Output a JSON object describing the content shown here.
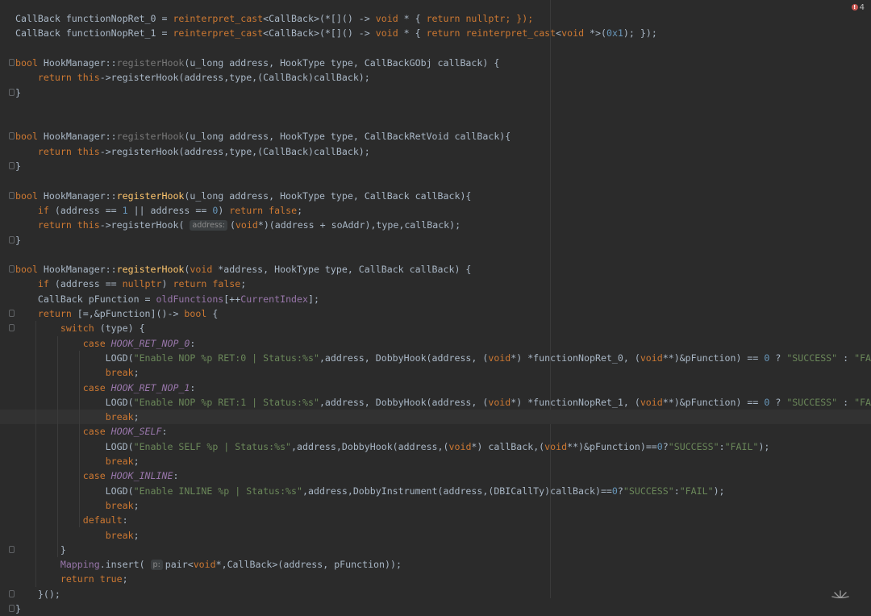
{
  "editor": {
    "error_count": "4",
    "error_icon": "error-icon",
    "lines": [
      {
        "tokens": [
          [
            "CallBack functionNopRet_0 = ",
            ""
          ],
          [
            "reinterpret_cast",
            "kw"
          ],
          [
            "<CallBack>(*[]() -> ",
            ""
          ],
          [
            "void",
            "kw"
          ],
          [
            " * { ",
            ""
          ],
          [
            "return",
            "kw"
          ],
          [
            " ",
            ""
          ],
          [
            "nullptr",
            "kw"
          ],
          [
            "; });",
            "kw"
          ]
        ]
      },
      {
        "tokens": [
          [
            "CallBack functionNopRet_1 = ",
            ""
          ],
          [
            "reinterpret_cast",
            "kw"
          ],
          [
            "<CallBack>(*[]() -> ",
            ""
          ],
          [
            "void",
            "kw"
          ],
          [
            " * { ",
            ""
          ],
          [
            "return",
            "kw"
          ],
          [
            " ",
            ""
          ],
          [
            "reinterpret_cast",
            "kw"
          ],
          [
            "<",
            ""
          ],
          [
            "void",
            "kw"
          ],
          [
            " *>(",
            ""
          ],
          [
            "0x1",
            "num"
          ],
          [
            "); });",
            ""
          ]
        ]
      },
      {
        "tokens": []
      },
      {
        "fold": true,
        "tokens": [
          [
            "bool",
            "kw"
          ],
          [
            " HookManager::",
            ""
          ],
          [
            "registerHook",
            "dim"
          ],
          [
            "(u_long address, HookType type, CallBackGObj callBack) {",
            ""
          ]
        ]
      },
      {
        "tokens": [
          [
            "    ",
            ""
          ],
          [
            "return",
            "kw"
          ],
          [
            " ",
            ""
          ],
          [
            "this",
            "kw"
          ],
          [
            "->registerHook(address,type,(CallBack)callBack);",
            ""
          ]
        ]
      },
      {
        "fold": true,
        "tokens": [
          [
            "}",
            ""
          ]
        ]
      },
      {
        "tokens": []
      },
      {
        "tokens": []
      },
      {
        "fold": true,
        "tokens": [
          [
            "bool",
            "kw"
          ],
          [
            " HookManager::",
            ""
          ],
          [
            "registerHook",
            "dim"
          ],
          [
            "(u_long address, HookType type, CallBackRetVoid callBack){",
            ""
          ]
        ]
      },
      {
        "tokens": [
          [
            "    ",
            ""
          ],
          [
            "return",
            "kw"
          ],
          [
            " ",
            ""
          ],
          [
            "this",
            "kw"
          ],
          [
            "->registerHook(address,type,(CallBack)callBack);",
            ""
          ]
        ]
      },
      {
        "fold": true,
        "tokens": [
          [
            "}",
            ""
          ]
        ]
      },
      {
        "tokens": []
      },
      {
        "fold": true,
        "tokens": [
          [
            "bool",
            "kw"
          ],
          [
            " HookManager::",
            ""
          ],
          [
            "registerHook",
            "fn"
          ],
          [
            "(u_long address, HookType type, CallBack callBack){",
            ""
          ]
        ]
      },
      {
        "tokens": [
          [
            "    ",
            ""
          ],
          [
            "if",
            "kw"
          ],
          [
            " (address == ",
            ""
          ],
          [
            "1",
            "num"
          ],
          [
            " || address == ",
            ""
          ],
          [
            "0",
            "num"
          ],
          [
            ") ",
            ""
          ],
          [
            "return",
            "kw"
          ],
          [
            " ",
            ""
          ],
          [
            "false",
            "kw"
          ],
          [
            ";",
            ""
          ]
        ]
      },
      {
        "tokens": [
          [
            "    ",
            ""
          ],
          [
            "return",
            "kw"
          ],
          [
            " ",
            ""
          ],
          [
            "this",
            "kw"
          ],
          [
            "->registerHook( ",
            ""
          ],
          [
            "address:",
            "hint"
          ],
          [
            "(",
            ""
          ],
          [
            "void",
            "kw"
          ],
          [
            "*)(address + soAddr),type,callBack);",
            ""
          ]
        ]
      },
      {
        "fold": true,
        "tokens": [
          [
            "}",
            ""
          ]
        ]
      },
      {
        "tokens": []
      },
      {
        "fold": true,
        "tokens": [
          [
            "bool",
            "kw"
          ],
          [
            " HookManager::",
            ""
          ],
          [
            "registerHook",
            "fn"
          ],
          [
            "(",
            ""
          ],
          [
            "void",
            "kw"
          ],
          [
            " *address, HookType type, CallBack callBack) {",
            ""
          ]
        ]
      },
      {
        "tokens": [
          [
            "    ",
            ""
          ],
          [
            "if",
            "kw"
          ],
          [
            " (address == ",
            ""
          ],
          [
            "nullptr",
            "kw"
          ],
          [
            ") ",
            ""
          ],
          [
            "return",
            "kw"
          ],
          [
            " ",
            ""
          ],
          [
            "false",
            "kw"
          ],
          [
            ";",
            ""
          ]
        ]
      },
      {
        "tokens": [
          [
            "    CallBack pFunction = ",
            ""
          ],
          [
            "oldFunctions",
            "field"
          ],
          [
            "[++",
            ""
          ],
          [
            "CurrentIndex",
            "field"
          ],
          [
            "];",
            ""
          ]
        ]
      },
      {
        "fold": true,
        "tokens": [
          [
            "    ",
            ""
          ],
          [
            "return",
            "kw"
          ],
          [
            " [=,&pFunction]()-> ",
            ""
          ],
          [
            "bool",
            "kw"
          ],
          [
            " {",
            ""
          ]
        ]
      },
      {
        "fold": true,
        "tokens": [
          [
            "        ",
            ""
          ],
          [
            "switch",
            "kw"
          ],
          [
            " (type) {",
            ""
          ]
        ]
      },
      {
        "tokens": [
          [
            "            ",
            ""
          ],
          [
            "case",
            "kw"
          ],
          [
            " ",
            ""
          ],
          [
            "HOOK_RET_NOP_0",
            "const"
          ],
          [
            ":",
            ""
          ]
        ]
      },
      {
        "tokens": [
          [
            "                LOGD(",
            ""
          ],
          [
            "\"Enable NOP %p RET:0 | Status:%s\"",
            "str"
          ],
          [
            ",address, DobbyHook(address, (",
            ""
          ],
          [
            "void",
            "kw"
          ],
          [
            "*) *functionNopRet_0, (",
            ""
          ],
          [
            "void",
            "kw"
          ],
          [
            "**)&pFunction) == ",
            ""
          ],
          [
            "0",
            "num"
          ],
          [
            " ? ",
            ""
          ],
          [
            "\"SUCCESS\"",
            "str"
          ],
          [
            " : ",
            ""
          ],
          [
            "\"FAIL\"",
            "str"
          ],
          [
            ");",
            ""
          ]
        ]
      },
      {
        "tokens": [
          [
            "                ",
            ""
          ],
          [
            "break",
            "kw"
          ],
          [
            ";",
            ""
          ]
        ]
      },
      {
        "tokens": [
          [
            "            ",
            ""
          ],
          [
            "case",
            "kw"
          ],
          [
            " ",
            ""
          ],
          [
            "HOOK_RET_NOP_1",
            "const"
          ],
          [
            ":",
            ""
          ]
        ]
      },
      {
        "tokens": [
          [
            "                LOGD(",
            ""
          ],
          [
            "\"Enable NOP %p RET:1 | Status:%s\"",
            "str"
          ],
          [
            ",address, DobbyHook(address, (",
            ""
          ],
          [
            "void",
            "kw"
          ],
          [
            "*) *functionNopRet_1, (",
            ""
          ],
          [
            "void",
            "kw"
          ],
          [
            "**)&pFunction) == ",
            ""
          ],
          [
            "0",
            "num"
          ],
          [
            " ? ",
            ""
          ],
          [
            "\"SUCCESS\"",
            "str"
          ],
          [
            " : ",
            ""
          ],
          [
            "\"FAIL\"",
            "str"
          ],
          [
            ");",
            ""
          ]
        ]
      },
      {
        "caret": true,
        "tokens": [
          [
            "                ",
            ""
          ],
          [
            "break",
            "kw"
          ],
          [
            ";",
            ""
          ]
        ]
      },
      {
        "tokens": [
          [
            "            ",
            ""
          ],
          [
            "case",
            "kw"
          ],
          [
            " ",
            ""
          ],
          [
            "HOOK_SELF",
            "const"
          ],
          [
            ":",
            ""
          ]
        ]
      },
      {
        "tokens": [
          [
            "                LOGD(",
            ""
          ],
          [
            "\"Enable SELF %p | Status:%s\"",
            "str"
          ],
          [
            ",address,DobbyHook(address,(",
            ""
          ],
          [
            "void",
            "kw"
          ],
          [
            "*) callBack,(",
            ""
          ],
          [
            "void",
            "kw"
          ],
          [
            "**)&pFunction)==",
            ""
          ],
          [
            "0",
            "num"
          ],
          [
            "?",
            ""
          ],
          [
            "\"SUCCESS\"",
            "str"
          ],
          [
            ":",
            ""
          ],
          [
            "\"FAIL\"",
            "str"
          ],
          [
            ");",
            ""
          ]
        ]
      },
      {
        "tokens": [
          [
            "                ",
            ""
          ],
          [
            "break",
            "kw"
          ],
          [
            ";",
            ""
          ]
        ]
      },
      {
        "tokens": [
          [
            "            ",
            ""
          ],
          [
            "case",
            "kw"
          ],
          [
            " ",
            ""
          ],
          [
            "HOOK_INLINE",
            "const"
          ],
          [
            ":",
            ""
          ]
        ]
      },
      {
        "tokens": [
          [
            "                LOGD(",
            ""
          ],
          [
            "\"Enable INLINE %p | Status:%s\"",
            "str"
          ],
          [
            ",address,DobbyInstrument(address,(DBICallTy)callBack)==",
            ""
          ],
          [
            "0",
            "num"
          ],
          [
            "?",
            ""
          ],
          [
            "\"SUCCESS\"",
            "str"
          ],
          [
            ":",
            ""
          ],
          [
            "\"FAIL\"",
            "str"
          ],
          [
            ");",
            ""
          ]
        ]
      },
      {
        "tokens": [
          [
            "                ",
            ""
          ],
          [
            "break",
            "kw"
          ],
          [
            ";",
            ""
          ]
        ]
      },
      {
        "tokens": [
          [
            "            ",
            ""
          ],
          [
            "default",
            "kw"
          ],
          [
            ":",
            ""
          ]
        ]
      },
      {
        "tokens": [
          [
            "                ",
            ""
          ],
          [
            "break",
            "kw"
          ],
          [
            ";",
            ""
          ]
        ]
      },
      {
        "fold": true,
        "tokens": [
          [
            "        }",
            ""
          ]
        ]
      },
      {
        "tokens": [
          [
            "        ",
            ""
          ],
          [
            "Mapping",
            "field"
          ],
          [
            ".insert( ",
            ""
          ],
          [
            "p:",
            "hint"
          ],
          [
            "pair<",
            ""
          ],
          [
            "void",
            "kw"
          ],
          [
            "*,CallBack>(address, pFunction));",
            ""
          ]
        ]
      },
      {
        "tokens": [
          [
            "        ",
            ""
          ],
          [
            "return",
            "kw"
          ],
          [
            " ",
            ""
          ],
          [
            "true",
            "kw"
          ],
          [
            ";",
            ""
          ]
        ]
      },
      {
        "fold": true,
        "tokens": [
          [
            "    }();",
            ""
          ]
        ]
      },
      {
        "fold": true,
        "tokens": [
          [
            "}",
            ""
          ]
        ]
      }
    ]
  }
}
